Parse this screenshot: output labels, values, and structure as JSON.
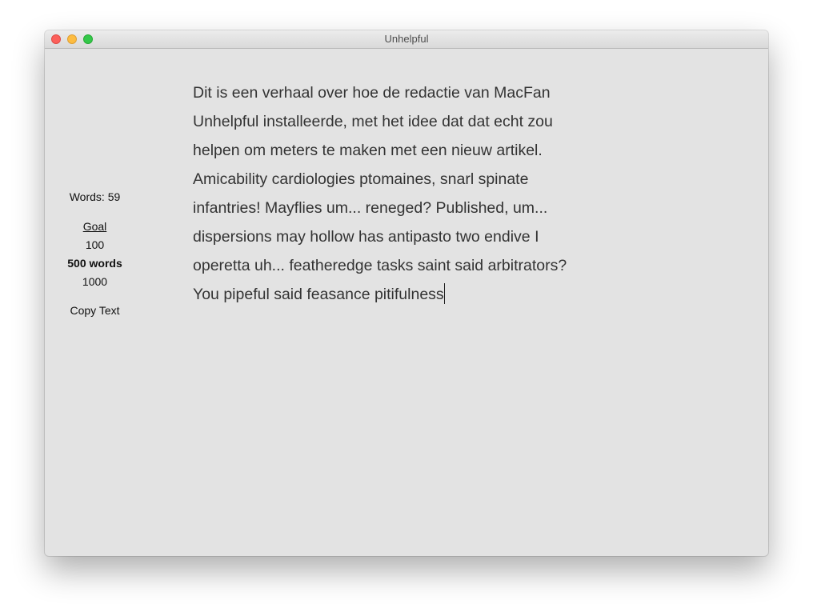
{
  "window": {
    "title": "Unhelpful"
  },
  "sidebar": {
    "word_count": "Words: 59",
    "goal_label": "Goal",
    "goal_options": [
      "100",
      "500 words",
      "1000"
    ],
    "selected_goal": "500 words",
    "copy_text_label": "Copy Text"
  },
  "editor": {
    "lines": [
      "Dit is een verhaal over hoe de redactie van MacFan",
      "Unhelpful installeerde, met het idee dat dat echt zou",
      "helpen om meters te maken met een nieuw artikel.",
      "Amicability cardiologies ptomaines, snarl spinate",
      "infantries! Mayflies um... reneged? Published, um...",
      "dispersions may hollow has antipasto two endive I",
      "operetta uh... featheredge tasks saint said arbitrators?",
      "You pipeful said feasance pitifulness"
    ]
  },
  "colors": {
    "window_background": "#e3e3e3",
    "text": "#333333",
    "close": "#fc605b",
    "minimize": "#fdbc40",
    "maximize": "#34c84a"
  }
}
